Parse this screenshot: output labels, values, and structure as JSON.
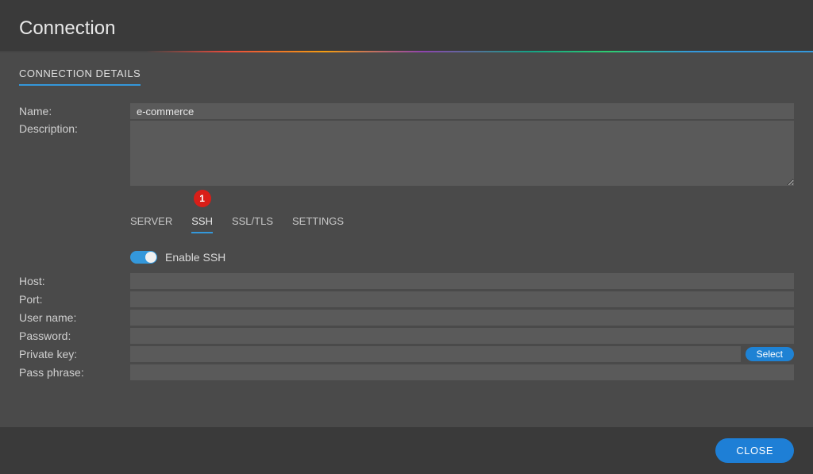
{
  "header": {
    "title": "Connection"
  },
  "section": {
    "title": "CONNECTION DETAILS"
  },
  "fields": {
    "name_label": "Name:",
    "name_value": "e-commerce",
    "description_label": "Description:",
    "description_value": ""
  },
  "tabs": {
    "server": "SERVER",
    "ssh": "SSH",
    "ssltls": "SSL/TLS",
    "settings": "SETTINGS",
    "ssh_badge": "1"
  },
  "ssh": {
    "enable_label": "Enable SSH",
    "host_label": "Host:",
    "host_value": "",
    "port_label": "Port:",
    "port_value": "",
    "user_label": "User name:",
    "user_value": "",
    "password_label": "Password:",
    "password_value": "",
    "privkey_label": "Private key:",
    "privkey_value": "",
    "select_label": "Select",
    "passphrase_label": "Pass phrase:",
    "passphrase_value": ""
  },
  "footer": {
    "close": "CLOSE"
  }
}
